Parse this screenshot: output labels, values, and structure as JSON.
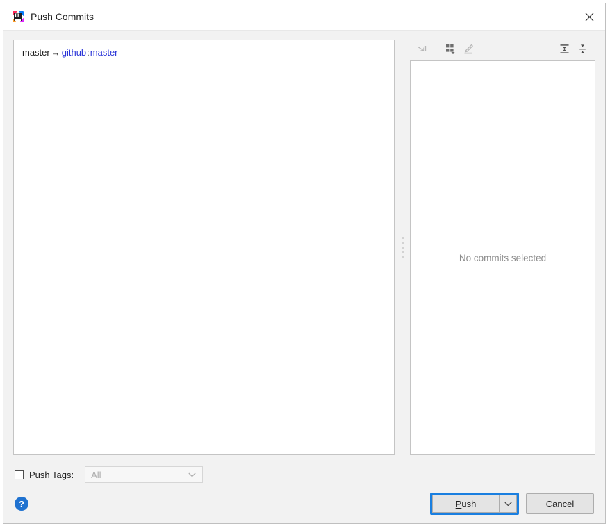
{
  "window": {
    "title": "Push Commits",
    "app_icon": "intellij-idea-icon",
    "close_label": "×"
  },
  "left_pane": {
    "branch": {
      "local": "master",
      "arrow": "→",
      "remote": "github",
      "separator": ":",
      "target": "master"
    }
  },
  "right_pane": {
    "toolbar": [
      {
        "name": "collapse-to-left-icon",
        "tooltip": "Collapse"
      },
      {
        "name": "group-by-icon",
        "tooltip": "Group By"
      },
      {
        "name": "edit-pencil-icon",
        "tooltip": "Edit"
      },
      {
        "name": "expand-all-icon",
        "tooltip": "Expand All"
      },
      {
        "name": "collapse-all-icon",
        "tooltip": "Collapse All"
      }
    ],
    "empty_message": "No commits selected"
  },
  "options": {
    "push_tags_checkbox": {
      "label_before": "Push ",
      "label_mnemonic": "T",
      "label_after": "ags:",
      "checked": false
    },
    "tags_dropdown": {
      "value": "All",
      "enabled": false
    }
  },
  "footer": {
    "help_label": "?",
    "push_button": {
      "label_before": "",
      "label_mnemonic": "P",
      "label_after": "ush",
      "has_dropdown": true,
      "focused": true
    },
    "cancel_button": {
      "label": "Cancel"
    }
  },
  "colors": {
    "dialog_background": "#f2f2f2",
    "titlebar_background": "#ffffff",
    "pane_background": "#ffffff",
    "pane_border": "#c4c4c4",
    "link_blue": "#2a35d8",
    "focus_blue": "#1a7fe0",
    "help_blue": "#1f72d0",
    "muted_text": "#8c8c8c"
  }
}
